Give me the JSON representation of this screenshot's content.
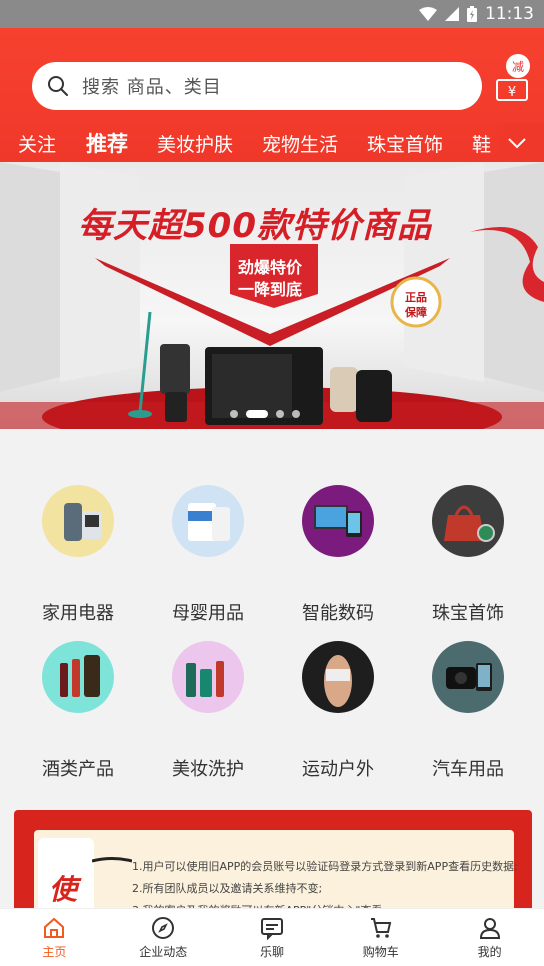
{
  "status_bar": {
    "time": "11:13"
  },
  "search": {
    "placeholder": "搜索 商品、类目"
  },
  "coupon": {
    "badge": "减",
    "symbol": "¥"
  },
  "tabs": [
    {
      "label": "关注"
    },
    {
      "label": "推荐",
      "active": true
    },
    {
      "label": "美妆护肤"
    },
    {
      "label": "宠物生活"
    },
    {
      "label": "珠宝首饰"
    },
    {
      "label": "鞋"
    }
  ],
  "banner": {
    "headline": "每天超500款特价商品",
    "promo_line1": "劲爆特价",
    "promo_line2": "一降到底",
    "seal_line1": "正品",
    "seal_line2": "保障"
  },
  "categories": [
    {
      "label": "家用电器",
      "icon": "appliance-icon"
    },
    {
      "label": "母婴用品",
      "icon": "baby-formula-icon"
    },
    {
      "label": "智能数码",
      "icon": "digital-devices-icon"
    },
    {
      "label": "珠宝首饰",
      "icon": "jewelry-bag-icon"
    },
    {
      "label": "酒类产品",
      "icon": "wine-icon"
    },
    {
      "label": "美妆洗护",
      "icon": "cosmetics-icon"
    },
    {
      "label": "运动户外",
      "icon": "fitness-icon"
    },
    {
      "label": "汽车用品",
      "icon": "dashcam-icon"
    }
  ],
  "notice": {
    "side_char": "使",
    "lines": [
      "1.用户可以使用旧APP的会员账号以验证码登录方式登录到新APP查看历史数据;",
      "2.所有团队成员以及邀请关系维持不变;",
      "3.我的客户及我的奖励可以在新APP\"分销中心\"查看;"
    ]
  },
  "bottom_nav": [
    {
      "label": "主页",
      "active": true
    },
    {
      "label": "企业动态"
    },
    {
      "label": "乐聊"
    },
    {
      "label": "购物车"
    },
    {
      "label": "我的"
    }
  ],
  "colors": {
    "brand_red": "#f0382a",
    "nav_active": "#f25b1f"
  }
}
